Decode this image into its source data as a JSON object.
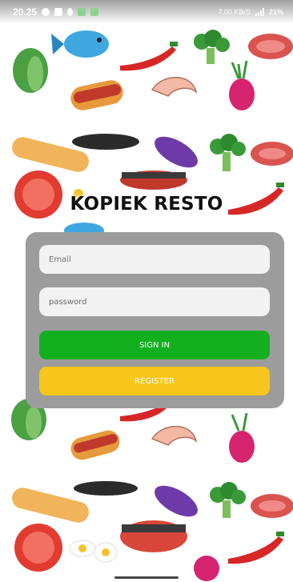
{
  "status_bar": {
    "time": "20.25",
    "network_speed": "7.00 KB/S",
    "battery": "21%",
    "icons": [
      "chat-icon",
      "gallery-icon",
      "tiktok-icon",
      "app-icon",
      "app-icon"
    ]
  },
  "app": {
    "title": "KOPIEK RESTO"
  },
  "login_form": {
    "email_placeholder": "Email",
    "password_placeholder": "password",
    "email_value": "",
    "password_value": ""
  },
  "buttons": {
    "sign_in_label": "SIGN IN",
    "register_label": "REGISTER"
  },
  "colors": {
    "card": "#9c9c9c",
    "sign_in": "#12b01f",
    "register": "#f7c51b",
    "field": "#f2f2f2"
  }
}
